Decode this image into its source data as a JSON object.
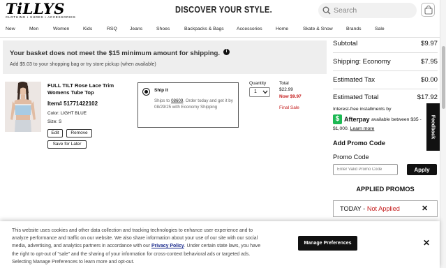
{
  "header": {
    "logo_text": "TiLLYS",
    "logo_tagline": "CLOTHING • SHOES • ACCESSORIES",
    "slogan": "DISCOVER YOUR STYLE.",
    "search_placeholder": "Search",
    "bag_icon": "shopping-bag-icon"
  },
  "nav": [
    "New",
    "Men",
    "Women",
    "Kids",
    "RSQ",
    "Jeans",
    "Shoes",
    "Backpacks & Bags",
    "Accessories",
    "Home",
    "Skate & Snow",
    "Brands",
    "Sale"
  ],
  "alert": {
    "title": "Your basket does not meet the $15 minimum amount for shipping.",
    "info_glyph": "i",
    "subtitle": "Add $5.03 to your shopping bag or try store pickup (when available)"
  },
  "item": {
    "name": "FULL TILT Rose Lace Trim Womens Tube Top",
    "item_no": "Item# 51771422102",
    "color": "Color: LIGHT BLUE",
    "size": "Size: S",
    "edit_label": "Edit",
    "remove_label": "Remove",
    "save_label": "Save for Later",
    "ship_title": "Ship it",
    "ship_text_prefix": "Ships to ",
    "ship_zip": "08609",
    "ship_text_suffix": ". Order today and get it by 08/29/25 with Economy Shipping",
    "quantity_label": "Quantity",
    "quantity_value": "1",
    "total_label": "Total",
    "price_original": "$22.99",
    "price_now": "Now $9.97",
    "final_sale": "Final Sale"
  },
  "summary": {
    "subtotal_label": "Subtotal",
    "subtotal_value": "$9.97",
    "shipping_label": "Shipping: Economy",
    "shipping_value": "$7.95",
    "tax_label": "Estimated Tax",
    "tax_value": "$0.00",
    "total_label": "Estimated Total",
    "total_value": "$17.92",
    "interest_text": "Interest-free installments by",
    "afterpay_name": "Afterpay",
    "afterpay_range": "available between $35 -",
    "afterpay_max": "$1,000.",
    "learn_more": "Learn more",
    "promo_heading": "Add Promo Code",
    "promo_label": "Promo Code",
    "promo_placeholder": "Enter Valid Promo Code",
    "apply_label": "Apply",
    "applied_heading": "APPLIED PROMOS",
    "applied_name": "TODAY - ",
    "applied_status": "Not Applied"
  },
  "feedback_label": "Feedback",
  "cookie": {
    "text_before": "This website uses cookies and other data collection and tracking technologies to enhance user experience and to analyze performance and traffic on our website. We also share information about your use of our site with our social media, advertising, and analytics partners in accordance with our ",
    "policy_link": "Privacy Policy",
    "text_after": ". Under certain state laws, you have the right to opt-out of \"sale\" and the sharing of your information for cross-context behavioral ads or targeted ads. Selecting Manage Preferences to learn more and opt-out.",
    "manage_label": "Manage Preferences"
  },
  "colors": {
    "sale_red": "#c41a1a",
    "afterpay_green": "#1db954",
    "alert_bg": "#eeeeee"
  }
}
